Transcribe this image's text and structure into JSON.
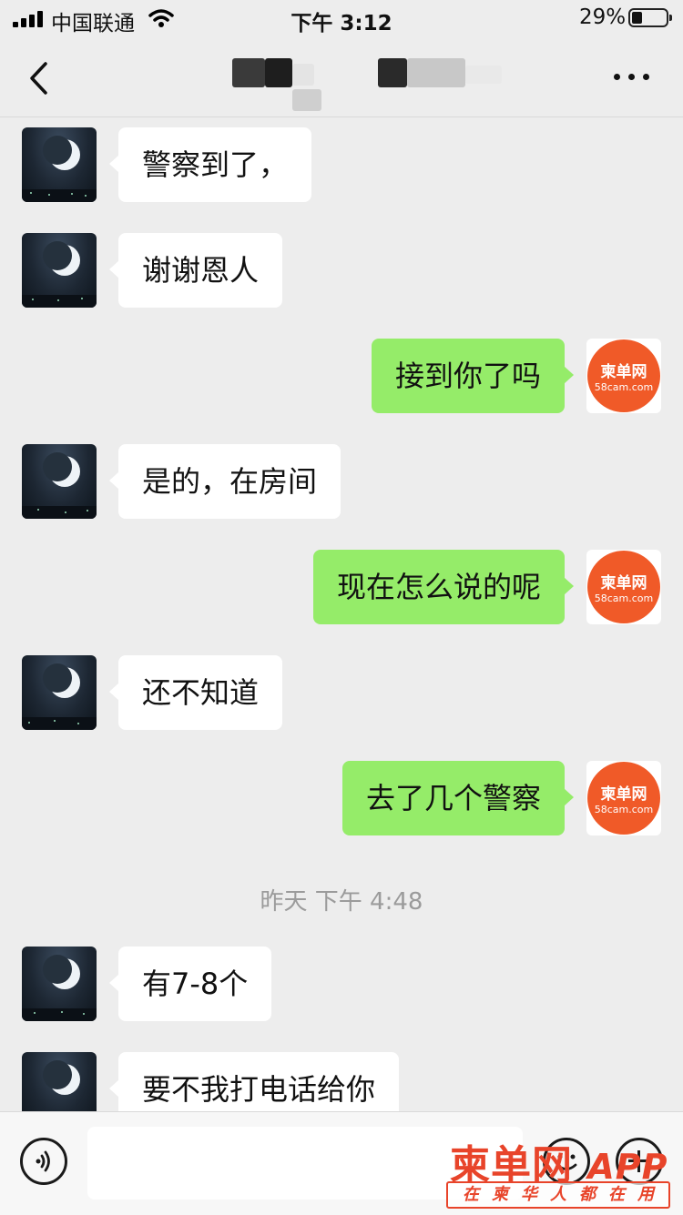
{
  "status_bar": {
    "carrier": "中国联通",
    "time": "下午 3:12",
    "battery": "29%",
    "battery_level": 0.29
  },
  "nav": {
    "back_icon": "chevron-left-icon",
    "title": "",
    "more_icon": "more-dots-icon"
  },
  "messages": [
    {
      "side": "left",
      "text": "警察到了，",
      "avatar": "moon-avatar"
    },
    {
      "side": "left",
      "text": "谢谢恩人",
      "avatar": "moon-avatar"
    },
    {
      "side": "right",
      "text": "接到你了吗",
      "avatar": "58cam-logo"
    },
    {
      "side": "left",
      "text": "是的，在房间",
      "avatar": "moon-avatar"
    },
    {
      "side": "right",
      "text": "现在怎么说的呢",
      "avatar": "58cam-logo"
    },
    {
      "side": "left",
      "text": "还不知道",
      "avatar": "moon-avatar"
    },
    {
      "side": "right",
      "text": "去了几个警察",
      "avatar": "58cam-logo"
    }
  ],
  "timestamp": "昨天 下午 4:48",
  "messages_after": [
    {
      "side": "left",
      "text": "有7-8个",
      "avatar": "moon-avatar"
    },
    {
      "side": "left",
      "text": "要不我打电话给你",
      "avatar": "moon-avatar"
    }
  ],
  "logo": {
    "name": "柬单网",
    "domain": "58cam.com",
    "color": "#f05a28"
  },
  "input_bar": {
    "placeholder": "",
    "voice_icon": "voice-icon",
    "emoji_icon": "emoji-icon",
    "plus_icon": "plus-icon"
  },
  "watermark": {
    "brand": "柬单网",
    "app": "APP",
    "tagline": "在柬华人都在用",
    "color": "#e8442a"
  },
  "colors": {
    "background": "#ededed",
    "bubble_self": "#95ec69",
    "bubble_other": "#ffffff"
  }
}
